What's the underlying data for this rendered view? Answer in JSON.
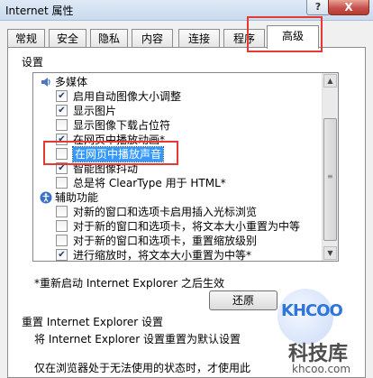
{
  "window": {
    "title": "Internet 属性",
    "help_label": "?",
    "close_label": "X"
  },
  "tabs": [
    {
      "label": "常规",
      "active": false
    },
    {
      "label": "安全",
      "active": false
    },
    {
      "label": "隐私",
      "active": false
    },
    {
      "label": "内容",
      "active": false
    },
    {
      "label": "连接",
      "active": false
    },
    {
      "label": "程序",
      "active": false
    },
    {
      "label": "高级",
      "active": true
    }
  ],
  "settings": {
    "section_label": "设置",
    "rows": [
      {
        "kind": "group",
        "label": "多媒体",
        "icon": "multimedia-icon"
      },
      {
        "kind": "check",
        "label": "启用自动图像大小调整",
        "checked": true
      },
      {
        "kind": "check",
        "label": "显示图片",
        "checked": true
      },
      {
        "kind": "check",
        "label": "显示图像下载占位符",
        "checked": false
      },
      {
        "kind": "check",
        "label": "在网页中播放动画*",
        "checked": true
      },
      {
        "kind": "check",
        "label": "在网页中播放声音",
        "checked": false,
        "selected": true
      },
      {
        "kind": "check",
        "label": "智能图像抖动",
        "checked": true
      },
      {
        "kind": "check",
        "label": "总是将 ClearType 用于 HTML*",
        "checked": false
      },
      {
        "kind": "group",
        "label": "辅助功能",
        "icon": "accessibility-icon"
      },
      {
        "kind": "check",
        "label": "对新的窗口和选项卡启用插入光标浏览",
        "checked": false
      },
      {
        "kind": "check",
        "label": "对于新的窗口和选项卡，将文本大小重置为中等",
        "checked": false
      },
      {
        "kind": "check",
        "label": "对于新的窗口和选项卡，重置缩放级别",
        "checked": false
      },
      {
        "kind": "check",
        "label": "进行缩放时，将文本大小重置为中等*",
        "checked": true
      }
    ],
    "restart_note": "*重新启动 Internet Explorer 之后生效",
    "restore_button": "还原",
    "reset_group_label": "重置 Internet Explorer 设置",
    "reset_desc": "将 Internet Explorer 设置重置为默认设置",
    "reset_note": "仅在浏览器处于无法使用的状态时，才使用此"
  },
  "watermark": {
    "logo": "KHCOO",
    "brand": "科技库",
    "url": "khcoo.com"
  },
  "colors": {
    "highlight_box": "#e53935",
    "selection": "#3399ff"
  }
}
